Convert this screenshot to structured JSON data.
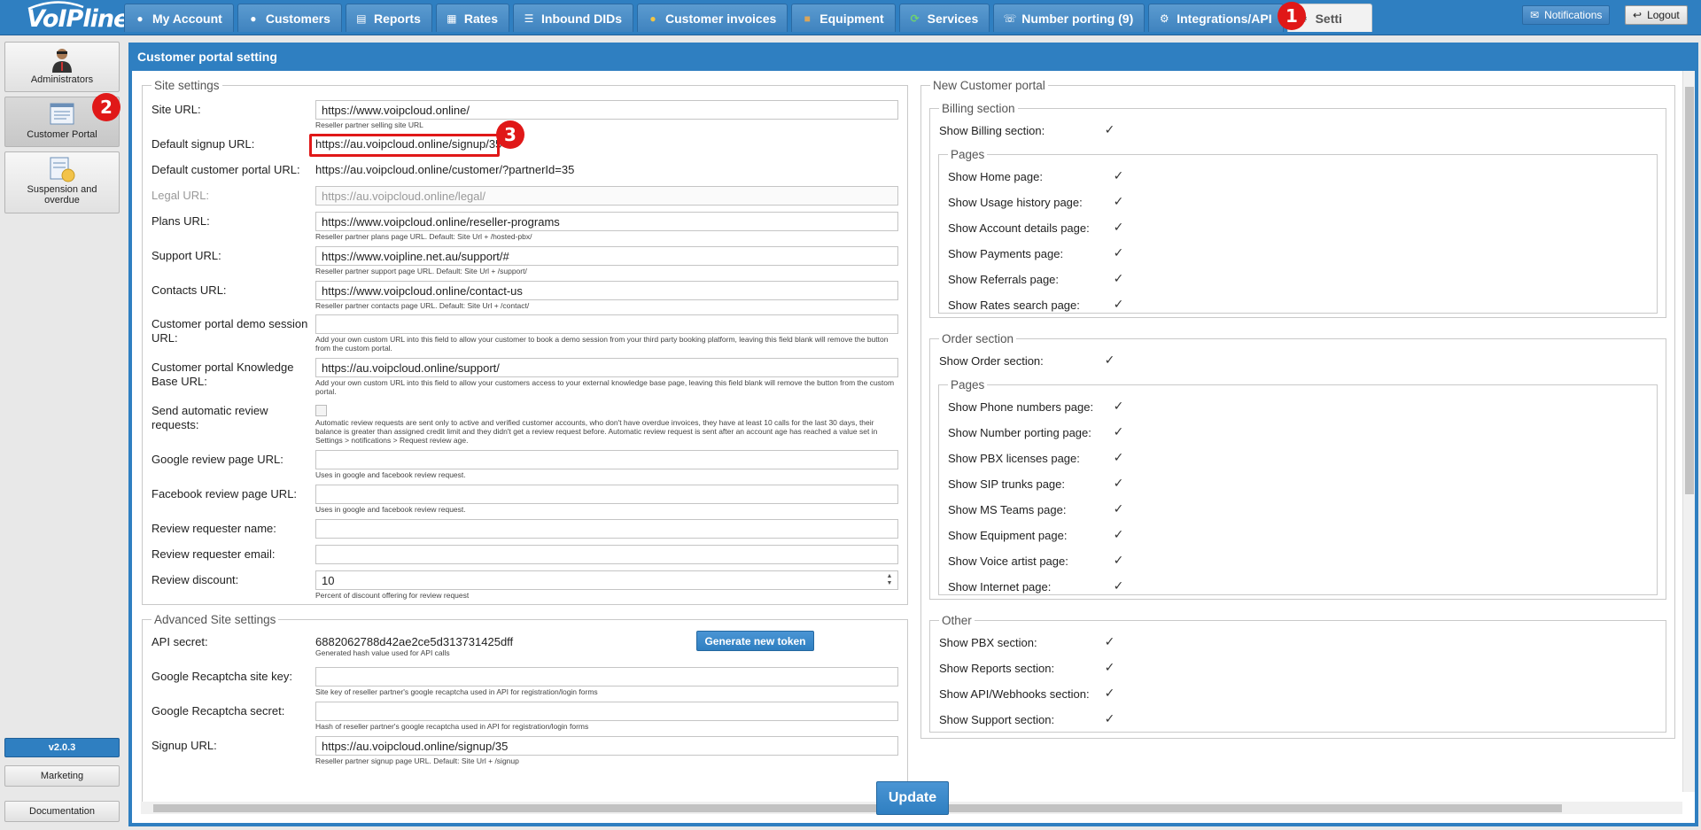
{
  "app": {
    "logo": "VoIPline",
    "version": "v2.0.3"
  },
  "top_tabs": [
    {
      "label": "My Account",
      "icon": "person-icon"
    },
    {
      "label": "Customers",
      "icon": "person-icon"
    },
    {
      "label": "Reports",
      "icon": "document-icon"
    },
    {
      "label": "Rates",
      "icon": "table-icon"
    },
    {
      "label": "Inbound DIDs",
      "icon": "list-icon"
    },
    {
      "label": "Customer invoices",
      "icon": "coins-icon"
    },
    {
      "label": "Equipment",
      "icon": "box-icon"
    },
    {
      "label": "Services",
      "icon": "cycle-icon"
    },
    {
      "label": "Number porting (9)",
      "icon": "phone-icon"
    },
    {
      "label": "Integrations/API",
      "icon": "gear-icon"
    },
    {
      "label": "Setti",
      "icon": "gears-icon"
    }
  ],
  "top_buttons": {
    "notifications": "Notifications",
    "logout": "Logout"
  },
  "sidebar": {
    "items": [
      {
        "label": "Administrators",
        "icon": "admin-icon"
      },
      {
        "label": "Customer Portal",
        "icon": "portal-icon"
      },
      {
        "label": "Suspension and overdue",
        "icon": "suspension-icon"
      }
    ],
    "marketing": "Marketing",
    "documentation": "Documentation"
  },
  "panel": {
    "title": "Customer portal setting",
    "update_button": "Update"
  },
  "site_settings": {
    "legend": "Site settings",
    "site_url": {
      "label": "Site URL:",
      "value": "https://www.voipcloud.online/",
      "hint": "Reseller partner selling site URL"
    },
    "default_signup_url": {
      "label": "Default signup URL:",
      "value": "https://au.voipcloud.online/signup/35"
    },
    "default_customer_portal_url": {
      "label": "Default customer portal URL:",
      "value": "https://au.voipcloud.online/customer/?partnerId=35"
    },
    "legal_url": {
      "label": "Legal URL:",
      "value": "https://au.voipcloud.online/legal/"
    },
    "plans_url": {
      "label": "Plans URL:",
      "value": "https://www.voipcloud.online/reseller-programs",
      "hint": "Reseller partner plans page URL. Default: Site Url + /hosted-pbx/"
    },
    "support_url": {
      "label": "Support URL:",
      "value": "https://www.voipline.net.au/support/#",
      "hint": "Reseller partner support page URL. Default: Site Url + /support/"
    },
    "contacts_url": {
      "label": "Contacts URL:",
      "value": "https://www.voipcloud.online/contact-us",
      "hint": "Reseller partner contacts page URL. Default: Site Url + /contact/"
    },
    "demo_session_url": {
      "label": "Customer portal demo session URL:",
      "value": "",
      "hint": "Add your own custom URL into this field to allow your customer to book a demo session from your third party booking platform, leaving this field blank will remove the button from the custom portal."
    },
    "knowledge_base_url": {
      "label": "Customer portal Knowledge Base URL:",
      "value": "https://au.voipcloud.online/support/",
      "hint": "Add your own custom URL into this field to allow your customers access to your external knowledge base page, leaving this field blank will remove the button from the custom portal."
    },
    "send_review_requests": {
      "label": "Send automatic review requests:",
      "hint": "Automatic review requests are sent only to active and verified customer accounts, who don't have overdue invoices, they have at least 10 calls for the last 30 days, their balance is greater than assigned credit limit and they didn't get a review request before. Automatic review request is sent after an account age has reached a value set in Settings > notifications > Request review age."
    },
    "google_review_url": {
      "label": "Google review page URL:",
      "value": "",
      "hint": "Uses in google and facebook review request."
    },
    "facebook_review_url": {
      "label": "Facebook review page URL:",
      "value": "",
      "hint": "Uses in google and facebook review request."
    },
    "review_requester_name": {
      "label": "Review requester name:",
      "value": ""
    },
    "review_requester_email": {
      "label": "Review requester email:",
      "value": ""
    },
    "review_discount": {
      "label": "Review discount:",
      "value": "10",
      "hint": "Percent of discount offering for review request"
    }
  },
  "advanced_settings": {
    "legend": "Advanced Site settings",
    "api_secret": {
      "label": "API secret:",
      "value": "6882062788d42ae2ce5d313731425dff",
      "hint": "Generated hash value used for API calls",
      "button": "Generate new token"
    },
    "recaptcha_site_key": {
      "label": "Google Recaptcha site key:",
      "value": "",
      "hint": "Site key of reseller partner's google recaptcha used in API for registration/login forms"
    },
    "recaptcha_secret": {
      "label": "Google Recaptcha secret:",
      "value": "",
      "hint": "Hash of reseller partner's google recaptcha used in API for registration/login forms"
    },
    "signup_url": {
      "label": "Signup URL:",
      "value": "https://au.voipcloud.online/signup/35",
      "hint": "Reseller partner signup page URL. Default: Site Url + /signup"
    }
  },
  "new_portal": {
    "legend": "New Customer portal",
    "billing": {
      "legend": "Billing section",
      "show_label": "Show Billing section:",
      "pages_legend": "Pages",
      "pages": [
        "Show Home page:",
        "Show Usage history page:",
        "Show Account details page:",
        "Show Payments page:",
        "Show Referrals page:",
        "Show Rates search page:"
      ]
    },
    "order": {
      "legend": "Order section",
      "show_label": "Show Order section:",
      "pages_legend": "Pages",
      "pages": [
        "Show Phone numbers page:",
        "Show Number porting page:",
        "Show PBX licenses page:",
        "Show SIP trunks page:",
        "Show MS Teams page:",
        "Show Equipment page:",
        "Show Voice artist page:",
        "Show Internet page:"
      ]
    },
    "other": {
      "legend": "Other",
      "items": [
        "Show PBX section:",
        "Show Reports section:",
        "Show API/Webhooks section:",
        "Show Support section:"
      ]
    }
  },
  "annotations": {
    "badge1": "1",
    "badge2": "2",
    "badge3": "3"
  },
  "colors": {
    "accent": "#2f7fc1",
    "badge": "#e01818"
  }
}
